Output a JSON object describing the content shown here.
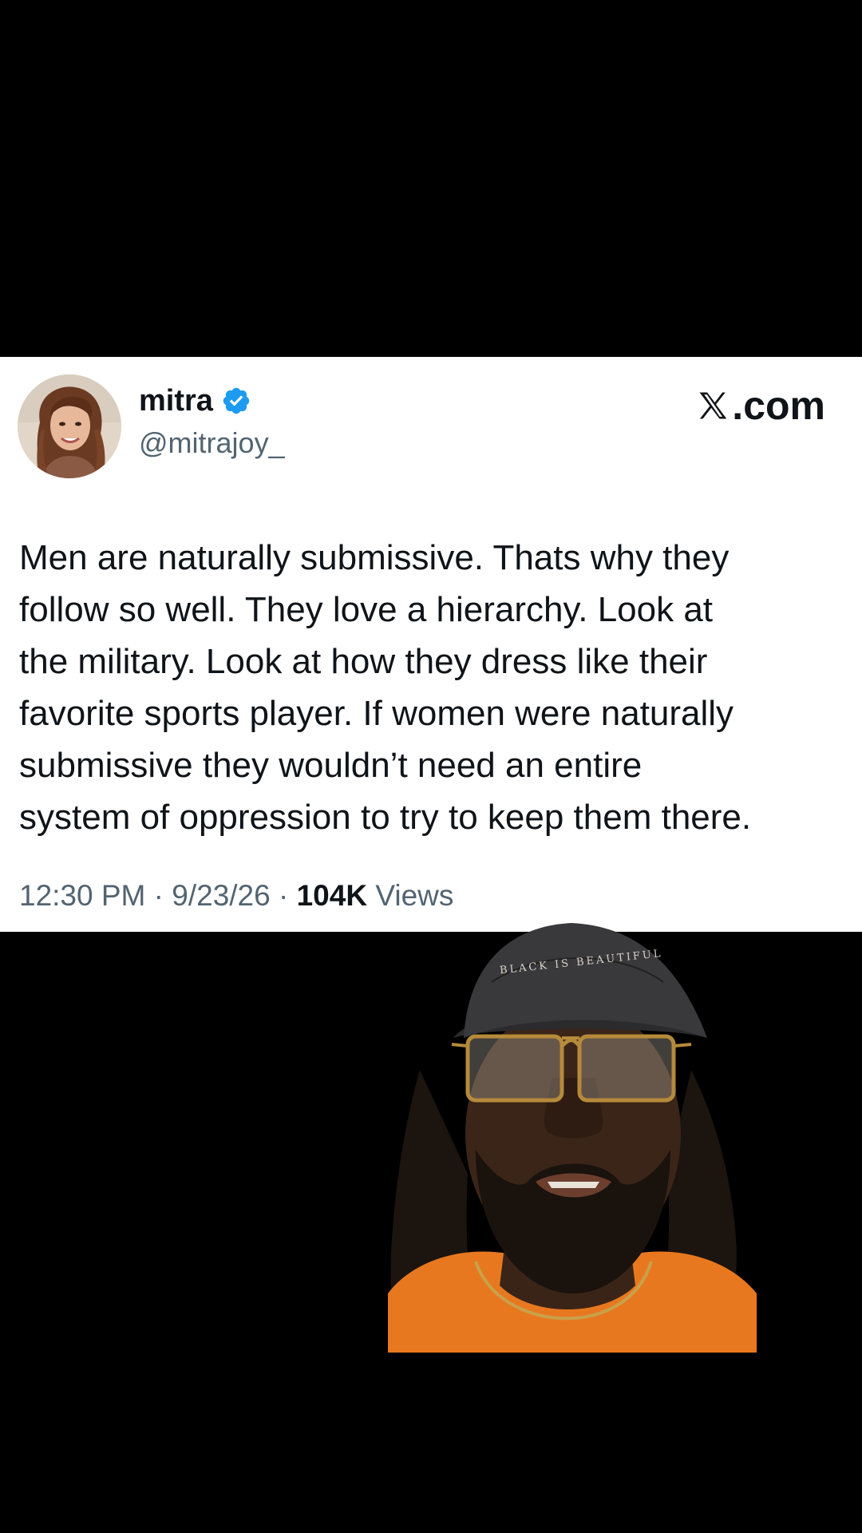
{
  "tweet": {
    "display_name": "mitra",
    "handle": "@mitrajoy_",
    "brand": ".com",
    "text": "Men are naturally submissive. Thats why they\nfollow so well. They love a hierarchy. Look at\nthe military. Look at how they dress like their\nfavorite sports player. If women were naturally\nsubmissive they wouldn’t need an entire\nsystem of oppression to try to keep them there.",
    "time": "12:30 PM",
    "separator": " · ",
    "date": "9/23/26",
    "views_count": "104K",
    "views_label": " Views"
  },
  "icons": {
    "verified": "verified-badge-icon",
    "brand_logo": "x-logo-icon",
    "avatar": "profile-photo"
  },
  "colors": {
    "verified_blue": "#1d9bf0",
    "text_primary": "#0f1419",
    "text_secondary": "#536471",
    "background": "#000000",
    "card": "#ffffff",
    "shirt": "#e8781f"
  },
  "overlay": {
    "cap_lettering": "BLACK IS BEAUTIFUL"
  }
}
